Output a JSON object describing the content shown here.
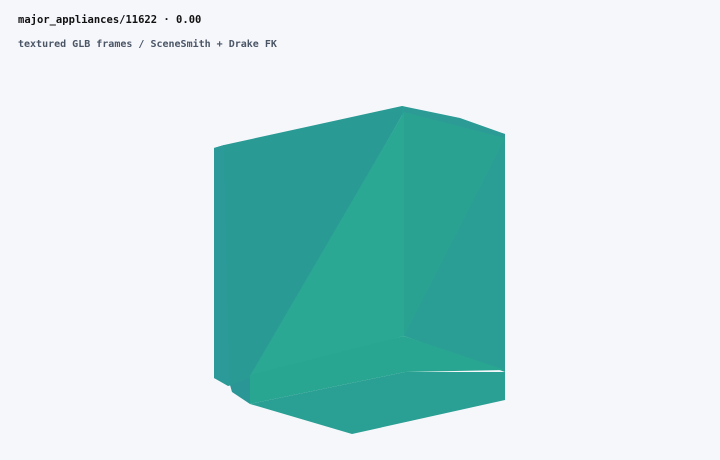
{
  "viewer": {
    "title_path": "major_appliances/11622",
    "title_separator": " · ",
    "title_value": "0.00",
    "subtitle": "textured GLB frames / SceneSmith + Drake FK"
  },
  "colors": {
    "background": "#f6f7fb",
    "mesh_primary": "#2aa893",
    "mesh_shadow": "#2a9a8f",
    "title_text": "#111111",
    "subtitle_text": "#4a5566"
  }
}
